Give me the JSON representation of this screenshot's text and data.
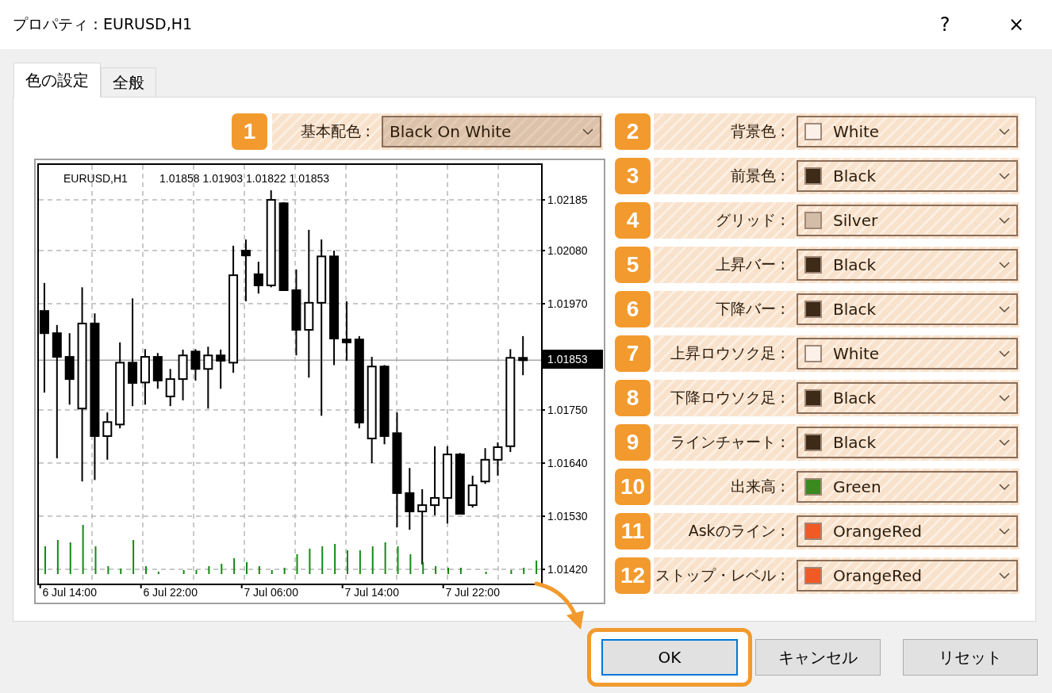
{
  "window": {
    "title": "プロパティ：EURUSD,H1",
    "help": "?",
    "close": "×"
  },
  "tabs": [
    {
      "label": "色の設定",
      "selected": true
    },
    {
      "label": "全般",
      "selected": false
    }
  ],
  "scheme": {
    "number": "1",
    "label": "基本配色 :",
    "value": "Black On White"
  },
  "chart": {
    "symbol": "EURUSD,H1",
    "ohlc": "1.01858 1.01903 1.01822 1.01853",
    "current_price": "1.01853",
    "chart_data": {
      "type": "candlestick",
      "categories": [
        null,
        null,
        "6 Jul 14:00",
        null,
        null,
        null,
        null,
        null,
        null,
        null,
        "6 Jul 22:00",
        null,
        null,
        null,
        null,
        null,
        null,
        null,
        "7 Jul 06:00",
        null,
        null,
        null,
        null,
        null,
        null,
        null,
        "7 Jul 14:00",
        null,
        null,
        null,
        null,
        null,
        null,
        null,
        "7 Jul 22:00",
        null,
        null,
        null,
        null,
        null
      ],
      "ylim": [
        1.01389,
        1.02259
      ],
      "grid": true,
      "ref_lines": [
        {
          "axis": "y",
          "value": 1.01853
        }
      ],
      "ohlc": [
        [
          1.01955,
          1.02013,
          1.01786,
          1.01909
        ],
        [
          1.01909,
          1.01926,
          1.0165,
          1.0186
        ],
        [
          1.0186,
          1.01909,
          1.01761,
          1.01814
        ],
        [
          1.01753,
          1.02004,
          1.01602,
          1.01929
        ],
        [
          1.01929,
          1.0195,
          1.01605,
          1.01696
        ],
        [
          1.01696,
          1.01745,
          1.01647,
          1.01725
        ],
        [
          1.0172,
          1.0189,
          1.01712,
          1.01848
        ],
        [
          1.01848,
          1.01981,
          1.01758,
          1.01806
        ],
        [
          1.01807,
          1.01876,
          1.01761,
          1.0186
        ],
        [
          1.0186,
          1.01868,
          1.01794,
          1.01811
        ],
        [
          1.01778,
          1.01835,
          1.01758,
          1.01814
        ],
        [
          1.01814,
          1.01875,
          1.0177,
          1.01863
        ],
        [
          1.01871,
          1.01876,
          1.01811,
          1.01835
        ],
        [
          1.01835,
          1.01881,
          1.01753,
          1.01863
        ],
        [
          1.01863,
          1.01875,
          1.01794,
          1.01852
        ],
        [
          1.01848,
          1.0209,
          1.01827,
          1.02029
        ],
        [
          1.0208,
          1.02103,
          1.01975,
          1.0207
        ],
        [
          1.02031,
          1.02057,
          1.01991,
          1.02008
        ],
        [
          1.02008,
          1.02205,
          1.02004,
          1.02185
        ],
        [
          1.02178,
          1.0218,
          1.01998,
          1.01998
        ],
        [
          1.01998,
          1.02041,
          1.01863,
          1.01916
        ],
        [
          1.01916,
          1.02123,
          1.01817,
          1.01972
        ],
        [
          1.01972,
          1.02103,
          1.01738,
          1.02068
        ],
        [
          1.02068,
          1.0208,
          1.01843,
          1.01898
        ],
        [
          1.01896,
          1.01975,
          1.01852,
          1.0189
        ],
        [
          1.01896,
          1.01903,
          1.01712,
          1.01724
        ],
        [
          1.01691,
          1.0186,
          1.0164,
          1.0184
        ],
        [
          1.0184,
          1.01843,
          1.01679,
          1.01696
        ],
        [
          1.01702,
          1.01745,
          1.01507,
          1.01578
        ],
        [
          1.01578,
          1.0163,
          1.01502,
          1.0154
        ],
        [
          1.0154,
          1.01586,
          1.0143,
          1.01553
        ],
        [
          1.01553,
          1.01675,
          1.01532,
          1.01568
        ],
        [
          1.01568,
          1.01675,
          1.01515,
          1.01658
        ],
        [
          1.01658,
          1.01661,
          1.01535,
          1.01535
        ],
        [
          1.01553,
          1.01614,
          1.01548,
          1.01594
        ],
        [
          1.01602,
          1.01671,
          1.01597,
          1.01647
        ],
        [
          1.01647,
          1.01683,
          1.01614,
          1.01673
        ],
        [
          1.01675,
          1.01876,
          1.01663,
          1.01858
        ],
        [
          1.01858,
          1.01903,
          1.01822,
          1.01853
        ],
        null
      ],
      "yticks": [
        {
          "value": 1.02185,
          "label": "1.02185"
        },
        {
          "value": 1.0208,
          "label": "1.02080"
        },
        {
          "value": 1.0197,
          "label": "1.01970"
        },
        {
          "value": 1.0175,
          "label": "1.01750"
        },
        {
          "value": 1.0164,
          "label": "1.01640"
        },
        {
          "value": 1.0153,
          "label": "1.01530"
        },
        {
          "value": 1.0142,
          "label": "1.01420"
        }
      ]
    }
  },
  "color_rows": [
    {
      "number": "2",
      "label": "背景色 :",
      "value": "White",
      "color": "#fbf1e8"
    },
    {
      "number": "3",
      "label": "前景色 :",
      "value": "Black",
      "color": "#3d2a17"
    },
    {
      "number": "4",
      "label": "グリッド :",
      "value": "Silver",
      "color": "#d3bda8"
    },
    {
      "number": "5",
      "label": "上昇バー :",
      "value": "Black",
      "color": "#3d2a17"
    },
    {
      "number": "6",
      "label": "下降バー :",
      "value": "Black",
      "color": "#3d2a17"
    },
    {
      "number": "7",
      "label": "上昇ロウソク足 :",
      "value": "White",
      "color": "#fbf1e8"
    },
    {
      "number": "8",
      "label": "下降ロウソク足 :",
      "value": "Black",
      "color": "#3d2a17"
    },
    {
      "number": "9",
      "label": "ラインチャート :",
      "value": "Black",
      "color": "#3d2a17"
    },
    {
      "number": "10",
      "label": "出来高 :",
      "value": "Green",
      "color": "#3a8a1e"
    },
    {
      "number": "11",
      "label": "Askのライン :",
      "value": "OrangeRed",
      "color": "#f05a24"
    },
    {
      "number": "12",
      "label": "ストップ・レベル :",
      "value": "OrangeRed",
      "color": "#f05a24"
    }
  ],
  "buttons": [
    {
      "label": "OK",
      "highlighted": true
    },
    {
      "label": "キャンセル",
      "highlighted": false
    },
    {
      "label": "リセット",
      "highlighted": false
    }
  ]
}
